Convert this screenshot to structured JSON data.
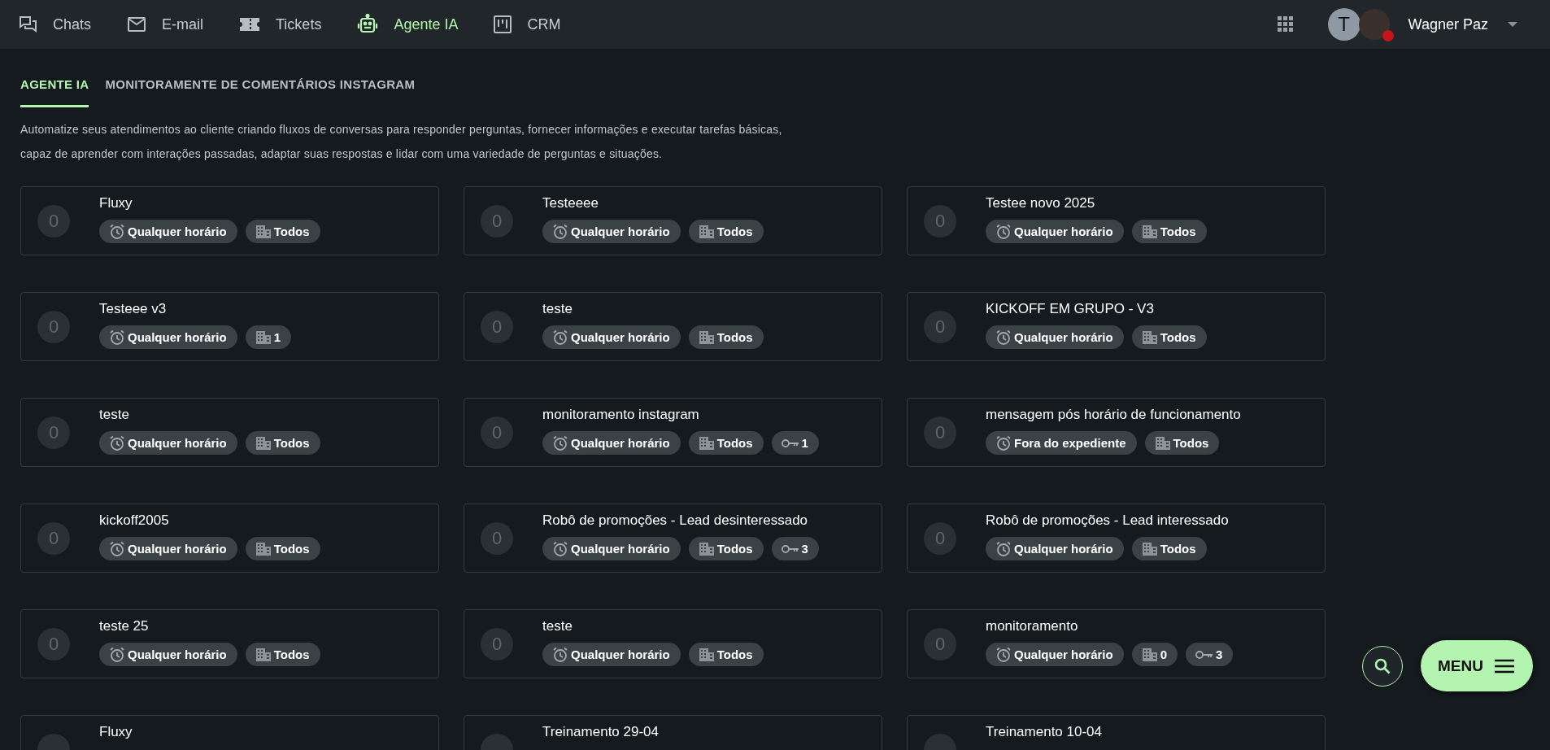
{
  "nav": {
    "items": [
      {
        "label": "Chats",
        "kind": "chats",
        "selected": false
      },
      {
        "label": "E-mail",
        "kind": "email",
        "selected": false
      },
      {
        "label": "Tickets",
        "kind": "tickets",
        "selected": false
      },
      {
        "label": "Agente IA",
        "kind": "agent",
        "selected": true
      },
      {
        "label": "CRM",
        "kind": "crm",
        "selected": false
      }
    ],
    "user": {
      "initial": "T",
      "name": "Wagner Paz"
    }
  },
  "tabs": [
    {
      "label": "AGENTE IA",
      "selected": true
    },
    {
      "label": "MONITORAMENTE DE COMENTÁRIOS INSTAGRAM",
      "selected": false
    }
  ],
  "description": [
    "Automatize seus atendimentos ao cliente criando fluxos de conversas para responder perguntas, fornecer informações e executar tarefas básicas,",
    "capaz de aprender com interações passadas, adaptar suas respostas e lidar com uma variedade de perguntas e situações."
  ],
  "cards": [
    {
      "count": "0",
      "title": "Fluxy",
      "chips": [
        {
          "kind": "schedule",
          "text": "Qualquer horário"
        },
        {
          "kind": "company",
          "text": "Todos"
        }
      ]
    },
    {
      "count": "0",
      "title": "Testeeee",
      "chips": [
        {
          "kind": "schedule",
          "text": "Qualquer horário"
        },
        {
          "kind": "company",
          "text": "Todos"
        }
      ]
    },
    {
      "count": "0",
      "title": "Testee novo 2025",
      "chips": [
        {
          "kind": "schedule",
          "text": "Qualquer horário"
        },
        {
          "kind": "company",
          "text": "Todos"
        }
      ]
    },
    {
      "count": "0",
      "title": "Testeee v3",
      "chips": [
        {
          "kind": "schedule",
          "text": "Qualquer horário"
        },
        {
          "kind": "company",
          "text": "1"
        }
      ]
    },
    {
      "count": "0",
      "title": "teste",
      "chips": [
        {
          "kind": "schedule",
          "text": "Qualquer horário"
        },
        {
          "kind": "company",
          "text": "Todos"
        }
      ]
    },
    {
      "count": "0",
      "title": "KICKOFF EM GRUPO - V3",
      "chips": [
        {
          "kind": "schedule",
          "text": "Qualquer horário"
        },
        {
          "kind": "company",
          "text": "Todos"
        }
      ]
    },
    {
      "count": "0",
      "title": "teste",
      "chips": [
        {
          "kind": "schedule",
          "text": "Qualquer horário"
        },
        {
          "kind": "company",
          "text": "Todos"
        }
      ]
    },
    {
      "count": "0",
      "title": "monitoramento instagram",
      "chips": [
        {
          "kind": "schedule",
          "text": "Qualquer horário"
        },
        {
          "kind": "company",
          "text": "Todos"
        },
        {
          "kind": "key",
          "text": "1"
        }
      ]
    },
    {
      "count": "0",
      "title": "mensagem pós horário de funcionamento",
      "chips": [
        {
          "kind": "schedule",
          "text": "Fora do expediente"
        },
        {
          "kind": "company",
          "text": "Todos"
        }
      ]
    },
    {
      "count": "0",
      "title": "kickoff2005",
      "chips": [
        {
          "kind": "schedule",
          "text": "Qualquer horário"
        },
        {
          "kind": "company",
          "text": "Todos"
        }
      ]
    },
    {
      "count": "0",
      "title": "Robô de promoções - Lead desinteressado",
      "chips": [
        {
          "kind": "schedule",
          "text": "Qualquer horário"
        },
        {
          "kind": "company",
          "text": "Todos"
        },
        {
          "kind": "key",
          "text": "3"
        }
      ]
    },
    {
      "count": "0",
      "title": "Robô de promoções - Lead interessado",
      "chips": [
        {
          "kind": "schedule",
          "text": "Qualquer horário"
        },
        {
          "kind": "company",
          "text": "Todos"
        }
      ]
    },
    {
      "count": "0",
      "title": "teste 25",
      "chips": [
        {
          "kind": "schedule",
          "text": "Qualquer horário"
        },
        {
          "kind": "company",
          "text": "Todos"
        }
      ]
    },
    {
      "count": "0",
      "title": "teste",
      "chips": [
        {
          "kind": "schedule",
          "text": "Qualquer horário"
        },
        {
          "kind": "company",
          "text": "Todos"
        }
      ]
    },
    {
      "count": "0",
      "title": "monitoramento",
      "chips": [
        {
          "kind": "schedule",
          "text": "Qualquer horário"
        },
        {
          "kind": "company",
          "text": "0"
        },
        {
          "kind": "key",
          "text": "3"
        }
      ]
    },
    {
      "title": "Fluxy"
    },
    {
      "title": "Treinamento 29-04"
    },
    {
      "title": "Treinamento 10-04"
    }
  ],
  "fab": {
    "menu_label": "MENU"
  }
}
